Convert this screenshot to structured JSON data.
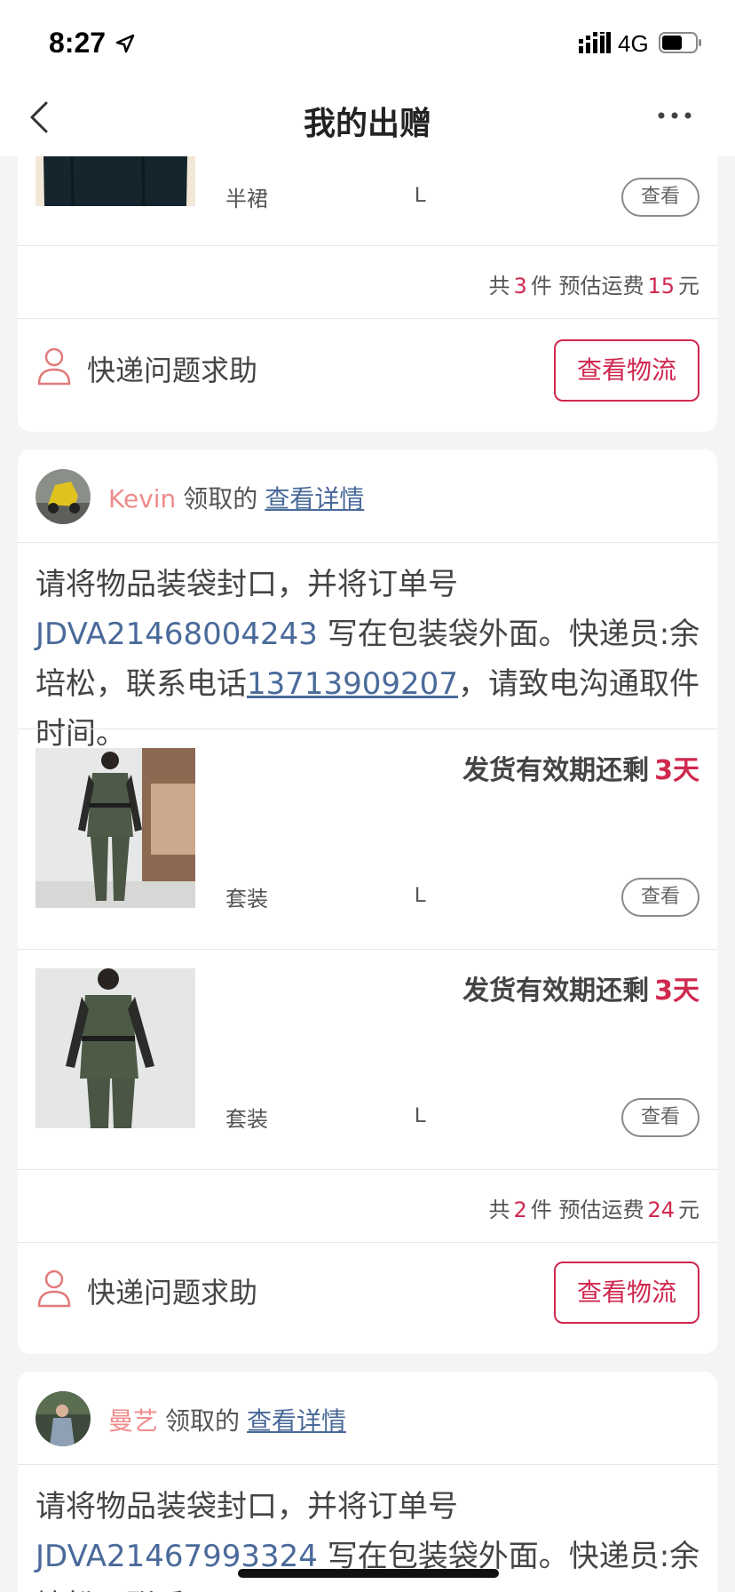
{
  "status_bar": {
    "time": "8:27",
    "network": "4G"
  },
  "nav": {
    "title": "我的出赠"
  },
  "colors": {
    "accent": "#d0284f",
    "link": "#4a6a9a",
    "claimer": "#ef8c8c"
  },
  "card1": {
    "item": {
      "category": "半裙",
      "size": "L",
      "view_label": "查看"
    },
    "summary": {
      "prefix": "共",
      "count": "3",
      "unit": "件 预估运费",
      "fee": "15",
      "currency": "元"
    },
    "help_label": "快递问题求助",
    "logistics_label": "查看物流"
  },
  "card2": {
    "claimer": "Kevin",
    "claimed_text": "领取的",
    "detail_label": "查看详情",
    "instr_pre": "请将物品装袋封口，并将订单号 ",
    "order_no": "JDVA21468004243",
    "instr_mid": " 写在包装袋外面。快递员:余培松，联系电话",
    "phone": "13713909207",
    "instr_post": "，请致电沟通取件时间。",
    "items": [
      {
        "validity": "发货有效期还剩",
        "days": "3天",
        "category": "套装",
        "size": "L",
        "view_label": "查看"
      },
      {
        "validity": "发货有效期还剩",
        "days": "3天",
        "category": "套装",
        "size": "L",
        "view_label": "查看"
      }
    ],
    "summary": {
      "prefix": "共",
      "count": "2",
      "unit": "件 预估运费",
      "fee": "24",
      "currency": "元"
    },
    "help_label": "快递问题求助",
    "logistics_label": "查看物流"
  },
  "card3": {
    "claimer": "曼艺",
    "claimed_text": "领取的",
    "detail_label": "查看详情",
    "instr_pre": "请将物品装袋封口，并将订单号 ",
    "order_no": "JDVA21467993324",
    "instr_mid": " 写在包装袋外面。快递员:余培松，联系"
  }
}
